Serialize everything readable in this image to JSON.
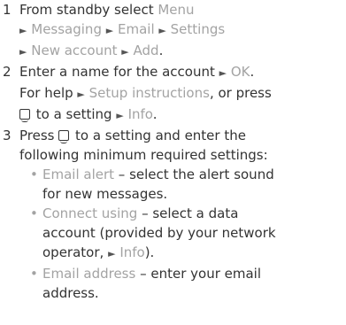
{
  "steps": [
    {
      "number": "1",
      "lines": [
        {
          "t1": "From standby select ",
          "h1": "Menu"
        },
        {
          "h1": "Messaging",
          "h2": "Email",
          "h3": "Settings"
        },
        {
          "h1": "New account",
          "h2": "Add",
          "t_end": "."
        }
      ]
    },
    {
      "number": "2",
      "line1_text": "Enter a name for the account ",
      "line1_hl": "OK",
      "line1_end": ".",
      "line2_text": "For help ",
      "line2_hl": "Setup instructions",
      "line2_end": ", or press",
      "line3_text": " to a setting ",
      "line3_hl": "Info",
      "line3_end": "."
    },
    {
      "number": "3",
      "line1_a": "Press ",
      "line1_b": " to a setting and enter the",
      "line2": "following minimum required settings:",
      "bullets": [
        {
          "label": "Email alert",
          "text_l1": " – select the alert sound",
          "text_l2": "for new messages."
        },
        {
          "label": "Connect using",
          "text_l1": " – select a data",
          "text_l2": "account (provided by your network",
          "text_l3_a": "operator, ",
          "text_l3_hl": "Info",
          "text_l3_b": ")."
        },
        {
          "label": "Email address",
          "text_l1": " – enter your email",
          "text_l2": "address."
        }
      ]
    }
  ],
  "arrow_glyph": "►",
  "bullet_glyph": "•",
  "icons": {
    "nav_key": "navigation-key-icon"
  },
  "colors": {
    "text": "#333333",
    "highlight": "#a3a3a3"
  }
}
